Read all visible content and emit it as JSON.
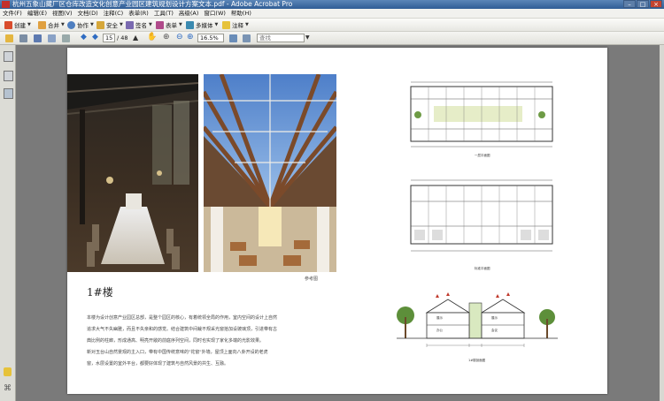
{
  "window": {
    "title": "杭州五象山藏厂区仓库改造文化创意产业园区建筑规划设计方案文本.pdf - Adobe Acrobat Pro",
    "controls": {
      "minimize": "–",
      "maximize": "□",
      "close": "×"
    }
  },
  "menu": [
    "文件(F)",
    "编辑(E)",
    "视图(V)",
    "文档(D)",
    "注释(C)",
    "表单(R)",
    "工具(T)",
    "高级(A)",
    "窗口(W)",
    "帮助(H)"
  ],
  "toolbar1": {
    "create": "创建",
    "combine": "合并",
    "collaborate": "协作",
    "secure": "安全",
    "sign": "签名",
    "forms": "表单",
    "multimedia": "多媒体",
    "comment": "注释"
  },
  "toolbar2": {
    "current_page": "15",
    "page_total": "/ 48",
    "zoom": "16.5%",
    "search_placeholder": "查找"
  },
  "document": {
    "caption": "参考图",
    "heading": "1#楼",
    "paragraph1": "本楼为设计创意产业园区总部，是整个园区的核心，有着统领全局的作用，室内空间的设计上自然",
    "paragraph2": "追求大气不失幽雅，而且不失亲和的感觉。结合建筑中间裁不规采光窗拾加设玻璃顶，引进带有古",
    "paragraph3": "典比例的柱廊，形成通高、明亮开敞的前庭序列空间，同时也实现了家化多端的光影效果。",
    "paragraph4": "新对玉台山自然景观的主入口，带有中国传统意味的\"花窗\"外墙，屋顶上面向八卦开设的老虎",
    "paragraph5": "窗，水层设置的室外平台，都要好体现了建筑与自然风景的共生、互融。",
    "plan_caption_1": "一层平面图",
    "plan_caption_2": "标准平面图",
    "section_caption": "1#楼剖面图",
    "section_labels": [
      "展示",
      "办公",
      "展示",
      "会议"
    ]
  },
  "colors": {
    "titlebar": "#2f5d95",
    "page_bg": "#ffffff",
    "viewer_bg": "#7a7a7a"
  }
}
